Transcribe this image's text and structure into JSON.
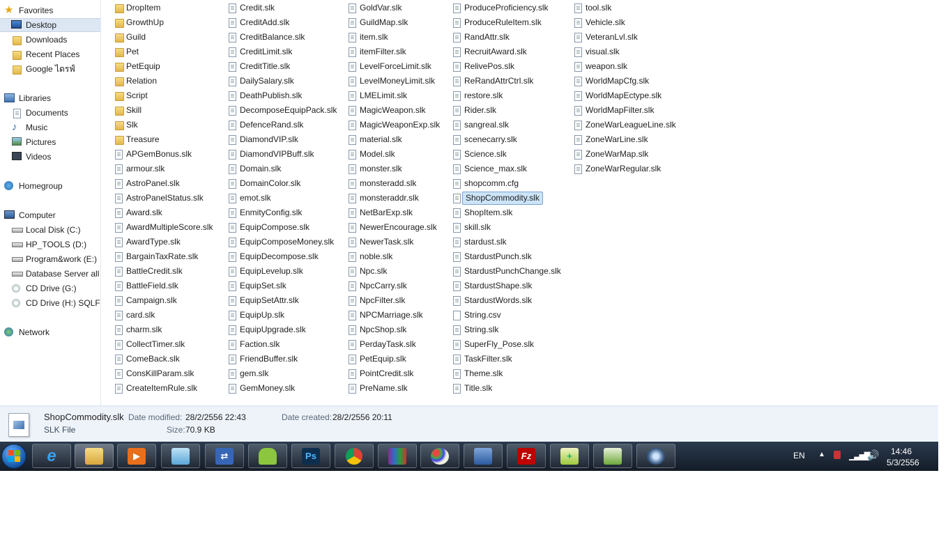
{
  "nav": {
    "favorites": "Favorites",
    "desktop": "Desktop",
    "downloads": "Downloads",
    "recent_places": "Recent Places",
    "google_drive": "Google ไดรฟ์",
    "libraries": "Libraries",
    "documents": "Documents",
    "music": "Music",
    "pictures": "Pictures",
    "videos": "Videos",
    "homegroup": "Homegroup",
    "computer": "Computer",
    "local_disk": "Local Disk (C:)",
    "hp_tools": "HP_TOOLS (D:)",
    "program_work": "Program&work (E:)",
    "database_server": "Database Server all p",
    "cd_g": "CD Drive (G:)",
    "cd_h": "CD Drive (H:) SQLFU",
    "network": "Network"
  },
  "files": {
    "col1": [
      "DropItem",
      "GrowthUp",
      "Guild",
      "Pet",
      "PetEquip",
      "Relation",
      "Script",
      "Skill",
      "Slk",
      "Treasure",
      "APGemBonus.slk",
      "armour.slk",
      "AstroPanel.slk",
      "AstroPanelStatus.slk",
      "Award.slk",
      "AwardMultipleScore.slk",
      "AwardType.slk",
      "BargainTaxRate.slk",
      "BattleCredit.slk",
      "BattleField.slk",
      "Campaign.slk",
      "card.slk",
      "charm.slk",
      "CollectTimer.slk",
      "ComeBack.slk",
      "ConsKillParam.slk",
      "CreateItemRule.slk"
    ],
    "col2": [
      "Credit.slk",
      "CreditAdd.slk",
      "CreditBalance.slk",
      "CreditLimit.slk",
      "CreditTitle.slk",
      "DailySalary.slk",
      "DeathPublish.slk",
      "DecomposeEquipPack.slk",
      "DefenceRand.slk",
      "DiamondVIP.slk",
      "DiamondVIPBuff.slk",
      "Domain.slk",
      "DomainColor.slk",
      "emot.slk",
      "EnmityConfig.slk",
      "EquipCompose.slk",
      "EquipComposeMoney.slk",
      "EquipDecompose.slk",
      "EquipLevelup.slk",
      "EquipSet.slk",
      "EquipSetAttr.slk",
      "EquipUp.slk",
      "EquipUpgrade.slk",
      "Faction.slk",
      "FriendBuffer.slk",
      "gem.slk",
      "GemMoney.slk"
    ],
    "col3": [
      "GoldVar.slk",
      "GuildMap.slk",
      "item.slk",
      "itemFilter.slk",
      "LevelForceLimit.slk",
      "LevelMoneyLimit.slk",
      "LMELimit.slk",
      "MagicWeapon.slk",
      "MagicWeaponExp.slk",
      "material.slk",
      "Model.slk",
      "monster.slk",
      "monsteradd.slk",
      "monsteraddr.slk",
      "NetBarExp.slk",
      "NewerEncourage.slk",
      "NewerTask.slk",
      "noble.slk",
      "Npc.slk",
      "NpcCarry.slk",
      "NpcFilter.slk",
      "NPCMarriage.slk",
      "NpcShop.slk",
      "PerdayTask.slk",
      "PetEquip.slk",
      "PointCredit.slk",
      "PreName.slk"
    ],
    "col4": [
      "ProduceProficiency.slk",
      "ProduceRuleItem.slk",
      "RandAttr.slk",
      "RecruitAward.slk",
      "RelivePos.slk",
      "ReRandAttrCtrl.slk",
      "restore.slk",
      "Rider.slk",
      "sangreal.slk",
      "scenecarry.slk",
      "Science.slk",
      "Science_max.slk",
      "shopcomm.cfg",
      "ShopCommodity.slk",
      "ShopItem.slk",
      "skill.slk",
      "stardust.slk",
      "StardustPunch.slk",
      "StardustPunchChange.slk",
      "StardustShape.slk",
      "StardustWords.slk",
      "String.csv",
      "String.slk",
      "SuperFly_Pose.slk",
      "TaskFilter.slk",
      "Theme.slk",
      "Title.slk"
    ],
    "col5": [
      "tool.slk",
      "Vehicle.slk",
      "VeteranLvl.slk",
      "visual.slk",
      "weapon.slk",
      "WorldMapCfg.slk",
      "WorldMapEctype.slk",
      "WorldMapFilter.slk",
      "ZoneWarLeagueLine.slk",
      "ZoneWarLine.slk",
      "ZoneWarMap.slk",
      "ZoneWarRegular.slk"
    ]
  },
  "details": {
    "filename": "ShopCommodity.slk",
    "filetype": "SLK File",
    "modified_label": "Date modified:",
    "modified_value": "28/2/2556 22:43",
    "created_label": "Date created:",
    "created_value": "28/2/2556 20:11",
    "size_label": "Size:",
    "size_value": "70.9 KB"
  },
  "taskbar": {
    "lang": "EN",
    "time": "14:46",
    "date": "5/3/2556",
    "photoshop_label": "Ps",
    "filezilla_label": "Fz"
  },
  "colors": {
    "accent": "#3f72b0",
    "selection": "#cce4f7",
    "taskbar": "#1b2533"
  }
}
